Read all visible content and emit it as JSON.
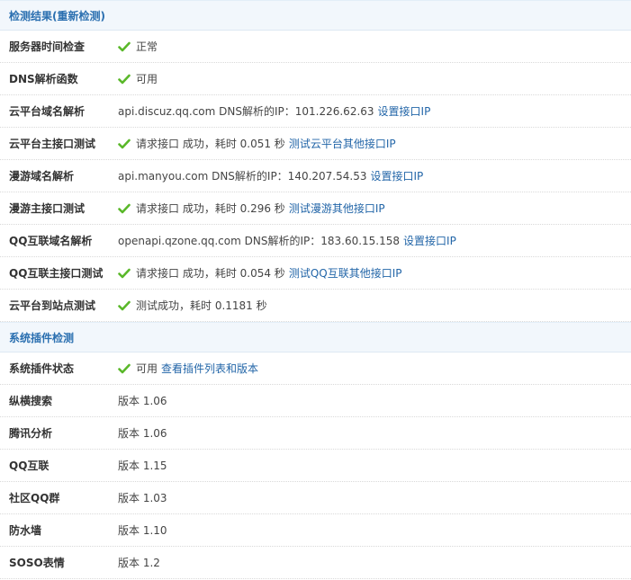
{
  "colors": {
    "accent": "#2a6fb0",
    "link": "#2366a8",
    "check": "#5ab82a"
  },
  "sections": [
    {
      "title": "检测结果(重新检测)",
      "rows": [
        {
          "label": "服务器时间检查",
          "check": true,
          "text": "正常"
        },
        {
          "label": "DNS解析函数",
          "check": true,
          "text": "可用"
        },
        {
          "label": "云平台域名解析",
          "check": false,
          "text": "api.discuz.qq.com DNS解析的IP：101.226.62.63",
          "link": "设置接口IP"
        },
        {
          "label": "云平台主接口测试",
          "check": true,
          "text": "请求接口 成功，耗时 0.051 秒",
          "link": "测试云平台其他接口IP"
        },
        {
          "label": "漫游域名解析",
          "check": false,
          "text": "api.manyou.com DNS解析的IP：140.207.54.53",
          "link": "设置接口IP"
        },
        {
          "label": "漫游主接口测试",
          "check": true,
          "text": "请求接口 成功，耗时 0.296 秒",
          "link": "测试漫游其他接口IP"
        },
        {
          "label": "QQ互联域名解析",
          "check": false,
          "text": "openapi.qzone.qq.com DNS解析的IP：183.60.15.158",
          "link": "设置接口IP"
        },
        {
          "label": "QQ互联主接口测试",
          "check": true,
          "text": "请求接口 成功，耗时 0.054 秒",
          "link": "测试QQ互联其他接口IP"
        },
        {
          "label": "云平台到站点测试",
          "check": true,
          "text": "测试成功，耗时 0.1181 秒"
        }
      ]
    },
    {
      "title": "系统插件检测",
      "rows": [
        {
          "label": "系统插件状态",
          "check": true,
          "text": "可用",
          "link": "查看插件列表和版本"
        },
        {
          "label": "纵横搜索",
          "check": false,
          "text": "版本 1.06"
        },
        {
          "label": "腾讯分析",
          "check": false,
          "text": "版本 1.06"
        },
        {
          "label": "QQ互联",
          "check": false,
          "text": "版本 1.15"
        },
        {
          "label": "社区QQ群",
          "check": false,
          "text": "版本 1.03"
        },
        {
          "label": "防水墙",
          "check": false,
          "text": "版本 1.10"
        },
        {
          "label": "SOSO表情",
          "check": false,
          "text": "版本 1.2"
        }
      ]
    }
  ]
}
